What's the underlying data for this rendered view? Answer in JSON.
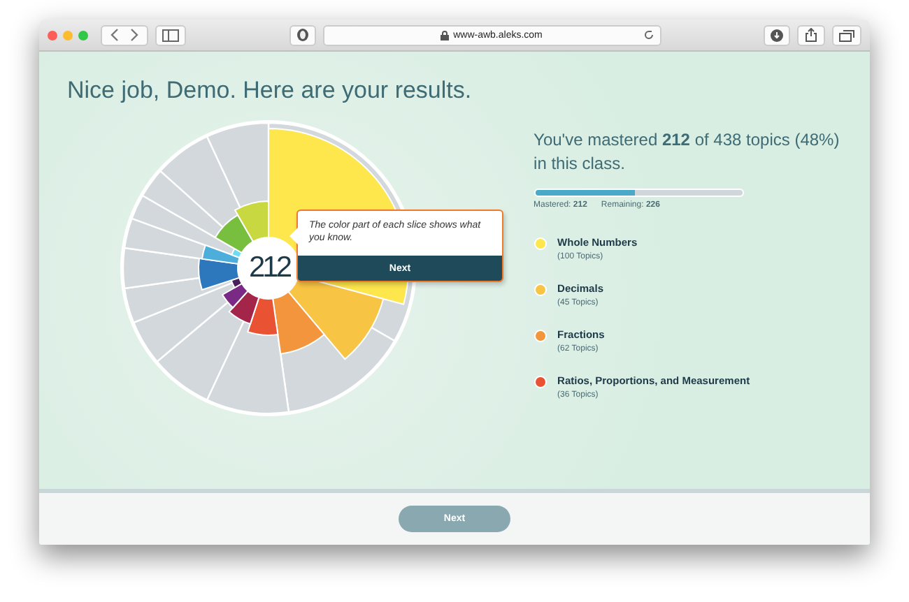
{
  "browser": {
    "url": "www-awb.aleks.com"
  },
  "heading": "Nice job, Demo. Here are your results.",
  "chart": {
    "center_label": "212"
  },
  "tooltip": {
    "text": "The color part of each slice shows what you know.",
    "button": "Next"
  },
  "summary": {
    "text": "You've mastered **212** of 438 topics (48%) in this class.",
    "level": 0.484,
    "mastered_label": "Mastered:",
    "mastered_value": "212",
    "remaining_label": "Remaining:",
    "remaining_value": "226"
  },
  "legend": [
    {
      "name": "Whole Numbers",
      "count": "(100 Topics)",
      "color": "#fde74c"
    },
    {
      "name": "Decimals",
      "count": "(45 Topics)",
      "color": "#f7c444"
    },
    {
      "name": "Fractions",
      "count": "(62 Topics)",
      "color": "#f2953d"
    },
    {
      "name": "Ratios, Proportions, and Measurement",
      "count": "(36 Topics)",
      "color": "#ea5234"
    }
  ],
  "footer": {
    "button": "Next"
  }
}
